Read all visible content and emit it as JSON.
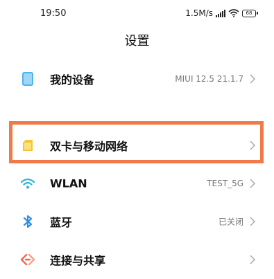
{
  "status_bar": {
    "time": "19:50",
    "speed": "1.5M/s",
    "battery": "68"
  },
  "page": {
    "title": "设置"
  },
  "settings_items": [
    {
      "label": "我的设备",
      "value": "MIUI 12.5 21.1.7",
      "icon": "device-icon",
      "icon_color": "#4fb3ef"
    },
    {
      "label": "双卡与移动网络",
      "value": "",
      "icon": "sim-card-icon",
      "icon_color": "#f6c431"
    },
    {
      "label": "WLAN",
      "value": "TEST_5G",
      "icon": "wifi-icon",
      "icon_color": "#2bb3d6"
    },
    {
      "label": "蓝牙",
      "value": "已关闭",
      "icon": "bluetooth-icon",
      "icon_color": "#2f8ee6"
    },
    {
      "label": "连接与共享",
      "value": "",
      "icon": "connection-sharing-icon",
      "icon_color": "#f2674a"
    }
  ],
  "colors": {
    "highlight_border": "#f07a4a"
  }
}
